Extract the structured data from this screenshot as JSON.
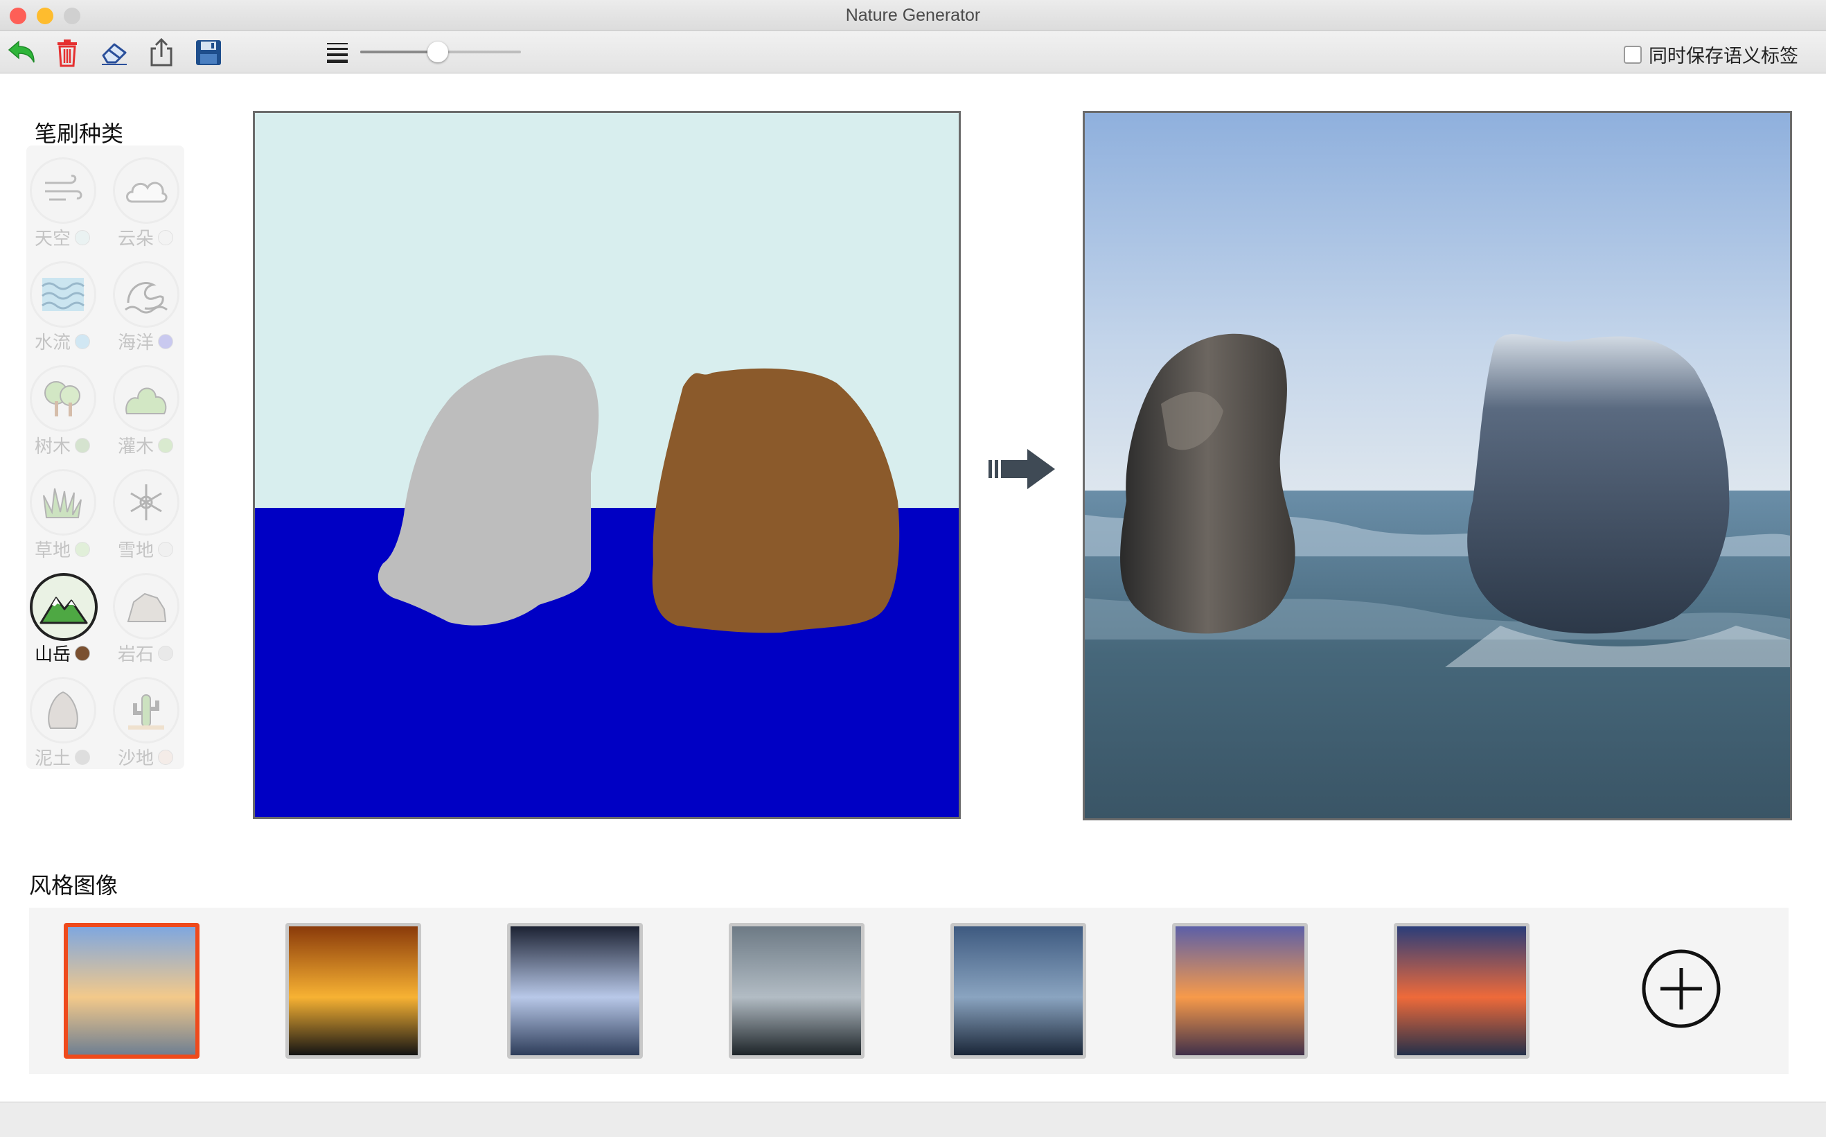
{
  "window": {
    "title": "Nature Generator",
    "traffic_lights": [
      "#fe5f57",
      "#febc2e",
      "#d0d0d0"
    ]
  },
  "toolbar": {
    "icons": [
      "undo-icon",
      "trash-icon",
      "eraser-icon",
      "share-icon",
      "save-icon",
      "brush-size-icon"
    ],
    "brush_size_fraction": 0.48,
    "save_semantic_label": "同时保存语义标签",
    "save_semantic_checked": false
  },
  "brush_panel": {
    "title": "笔刷种类",
    "selected": "山岳",
    "brushes": [
      {
        "label": "天空",
        "color": "#d8eeee",
        "icon": "wind-icon"
      },
      {
        "label": "云朵",
        "color": "#f0f0f0",
        "icon": "cloud-icon"
      },
      {
        "label": "水流",
        "color": "#8fd0f0",
        "icon": "water-icon"
      },
      {
        "label": "海洋",
        "color": "#7a7ae6",
        "icon": "wave-icon"
      },
      {
        "label": "树木",
        "color": "#9cc48a",
        "icon": "tree-icon"
      },
      {
        "label": "灌木",
        "color": "#a6d68a",
        "icon": "bush-icon"
      },
      {
        "label": "草地",
        "color": "#bde6a6",
        "icon": "grass-icon"
      },
      {
        "label": "雪地",
        "color": "#e9e9e9",
        "icon": "snowflake-icon"
      },
      {
        "label": "山岳",
        "color": "#7a5030",
        "icon": "mountain-icon"
      },
      {
        "label": "岩石",
        "color": "#d4d4d4",
        "icon": "rock-icon"
      },
      {
        "label": "泥土",
        "color": "#b4b4b4",
        "icon": "dirt-icon"
      },
      {
        "label": "沙地",
        "color": "#f4ddd2",
        "icon": "cactus-icon"
      }
    ]
  },
  "drawing_canvas": {
    "colors": {
      "sky": "#d8eeee",
      "sea": "#0000c4",
      "rock": "#bdbdbd",
      "mountain": "#8b5a2b"
    }
  },
  "arrow_icon": "run-arrow-icon",
  "style_panel": {
    "title": "风格图像",
    "selected_index": 0,
    "add_icon": "plus-circle-icon",
    "styles": [
      {
        "top": "#7fa7df",
        "mid": "#f3c98a",
        "bottom": "#6f7f92"
      },
      {
        "top": "#8a3a0a",
        "mid": "#f7b233",
        "bottom": "#141414"
      },
      {
        "top": "#1c2233",
        "mid": "#b8c8e8",
        "bottom": "#2e3d5a"
      },
      {
        "top": "#6d7a85",
        "mid": "#b2bcc4",
        "bottom": "#1d2428"
      },
      {
        "top": "#3e5a80",
        "mid": "#8aa4c0",
        "bottom": "#1a2638"
      },
      {
        "top": "#5b5fa8",
        "mid": "#f79a4a",
        "bottom": "#40304a"
      },
      {
        "top": "#2a3d7a",
        "mid": "#ee6a3a",
        "bottom": "#24304a"
      }
    ]
  }
}
